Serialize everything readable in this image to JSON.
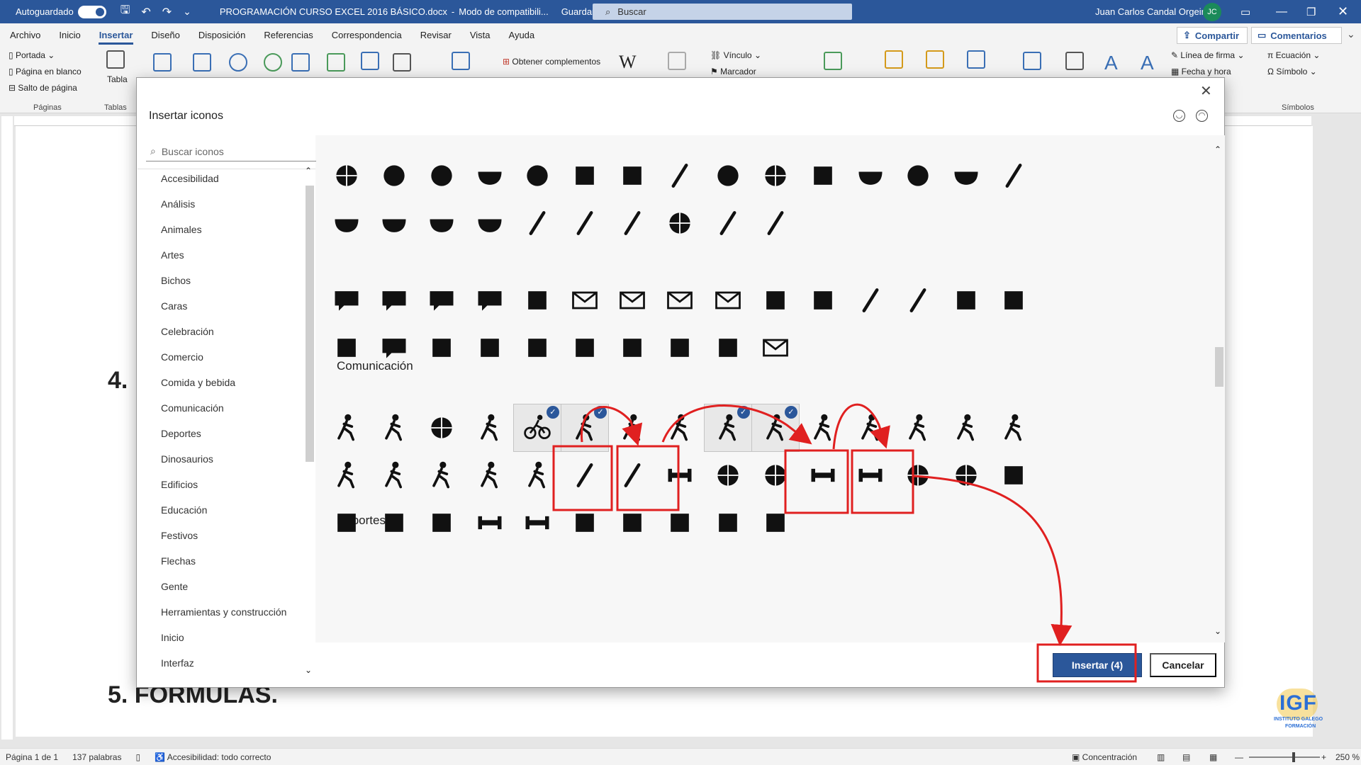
{
  "titlebar": {
    "autosave": "Autoguardado",
    "filename": "PROGRAMACIÓN CURSO EXCEL 2016 BÁSICO.docx",
    "mode": "Modo de compatibili...",
    "saving": "Guardando...",
    "search_placeholder": "Buscar",
    "user": "Juan Carlos Candal Orgeira",
    "initials": "JC"
  },
  "menu": {
    "tabs": [
      "Archivo",
      "Inicio",
      "Insertar",
      "Diseño",
      "Disposición",
      "Referencias",
      "Correspondencia",
      "Revisar",
      "Vista",
      "Ayuda"
    ],
    "active": "Insertar",
    "share": "Compartir",
    "comments": "Comentarios"
  },
  "ribbon": {
    "cover": "Portada",
    "blank": "Página en blanco",
    "break": "Salto de página",
    "table": "Tabla",
    "addins": "Obtener complementos",
    "link": "Vínculo",
    "bookmark": "Marcador",
    "signature": "Línea de firma",
    "datetime": "Fecha y hora",
    "equation": "Ecuación",
    "symbol": "Símbolo",
    "groups": {
      "pages": "Páginas",
      "tables": "Tablas",
      "symbols": "Símbolos"
    }
  },
  "document": {
    "heading4": "4.",
    "heading5": "5. FÓRMULAS."
  },
  "dialog": {
    "title": "Insertar iconos",
    "search_placeholder": "Buscar iconos",
    "categories": [
      "Accesibilidad",
      "Análisis",
      "Animales",
      "Artes",
      "Bichos",
      "Caras",
      "Celebración",
      "Comercio",
      "Comida y bebida",
      "Comunicación",
      "Deportes",
      "Dinosaurios",
      "Edificios",
      "Educación",
      "Festivos",
      "Flechas",
      "Gente",
      "Herramientas y construcción",
      "Inicio",
      "Interfaz"
    ],
    "sections": {
      "communication": "Comunicación",
      "sports": "Deportes"
    },
    "food_icons": [
      "orange-icon",
      "cherries-icon",
      "grapes-icon",
      "watermelon-icon",
      "avocado-icon",
      "hot-cup-icon",
      "mug-icon",
      "candy-icon",
      "cupcake-icon",
      "donut-icon",
      "ice-cream-icon",
      "cake-slice-icon",
      "lollipop-icon",
      "pie-icon",
      "popsicle-icon",
      "bowl-icon",
      "fruit-bowl-icon",
      "cloche-icon",
      "place-setting-icon",
      "fork-icon",
      "knife-icon",
      "spoon-icon",
      "plate-icon",
      "fork-knife-icon",
      "baby-bottle-icon"
    ],
    "comm_icons": [
      "speech-bubble-icon",
      "chat-icon",
      "conversation-icon",
      "thought-icon",
      "network-icon",
      "envelope-icon",
      "open-mail-icon",
      "email-at-icon",
      "stamp-icon",
      "download-icon",
      "cloud-download-icon",
      "link-icon",
      "paper-plane-icon",
      "share-icon",
      "phone-icon",
      "rotary-phone-icon",
      "headset-icon",
      "paperclip-icon",
      "microphone-icon",
      "podcast-icon",
      "megaphone-person-icon",
      "megaphone-icon",
      "satellite-dish-icon",
      "satellite-icon",
      "newspaper-icon"
    ],
    "sport_icons": [
      "baseball-player-icon",
      "soccer-player-icon",
      "volleyball-player-icon",
      "tennis-player-icon",
      "cycling-icon",
      "skiing-icon",
      "downhill-ski-icon",
      "golf-icon",
      "hockey-icon",
      "skating-icon",
      "snowshoe-icon",
      "rowing-icon",
      "diving-icon",
      "swimming-wave-icon",
      "swimmer-icon",
      "weightlifting-icon",
      "gymnast-icon",
      "rhythmic-gymnastics-icon",
      "dancing-icon",
      "climbing-icon",
      "baseball-bat-icon",
      "cricket-icon",
      "dumbbell-icon",
      "sport-balls-icon",
      "basketball-icon",
      "football-icon",
      "rugby-icon",
      "soccer-ball-icon",
      "volleyball-icon",
      "ping-pong-icon",
      "racket-icon",
      "golf-bag-icon",
      "ice-skate-icon",
      "sled-icon",
      "skateboard-icon",
      "sailboat-icon",
      "canoe-icon",
      "kayak-icon",
      "flippers-icon",
      "footprints-icon"
    ],
    "selected": [
      "cycling-icon",
      "skiing-icon",
      "hockey-icon",
      "skating-icon"
    ],
    "insert": "Insertar (4)",
    "cancel": "Cancelar"
  },
  "status": {
    "page": "Página 1 de 1",
    "words": "137 palabras",
    "accessibility": "Accesibilidad: todo correcto",
    "focus": "Concentración",
    "zoom": "250 %"
  },
  "logo": {
    "text": "IGF",
    "sub1": "INSTITUTO GALEGO",
    "sub2": "FORMACIÓN"
  },
  "colors": {
    "accent": "#2b579a",
    "annotation": "#e02020"
  }
}
